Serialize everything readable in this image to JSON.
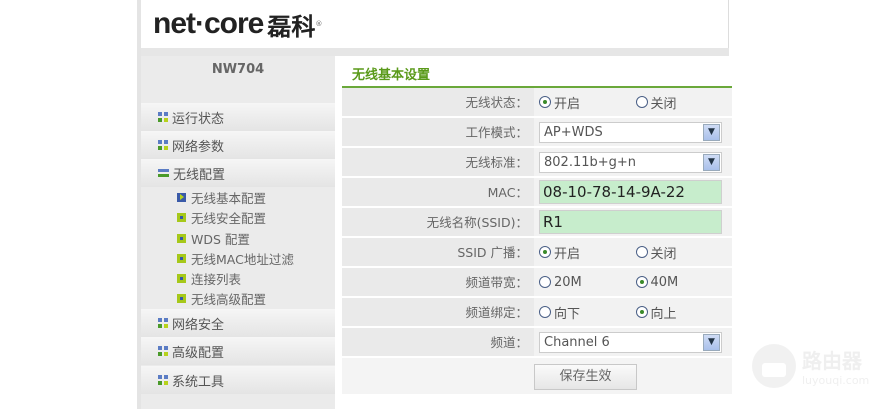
{
  "header": {
    "brand": "net·core",
    "brand_cn": "磊科",
    "registered": "®"
  },
  "sidebar": {
    "model": "NW704",
    "items": [
      {
        "label": "运行状态"
      },
      {
        "label": "网络参数"
      },
      {
        "label": "无线配置"
      },
      {
        "label": "网络安全"
      },
      {
        "label": "高级配置"
      },
      {
        "label": "系统工具"
      }
    ],
    "subitems": [
      {
        "label": "无线基本配置"
      },
      {
        "label": "无线安全配置"
      },
      {
        "label": "WDS 配置"
      },
      {
        "label": "无线MAC地址过滤"
      },
      {
        "label": "连接列表"
      },
      {
        "label": "无线高级配置"
      }
    ]
  },
  "main": {
    "title": "无线基本设置",
    "wireless_status": {
      "label": "无线状态：",
      "on": "开启",
      "off": "关闭"
    },
    "work_mode": {
      "label": "工作模式：",
      "value": "AP+WDS"
    },
    "standard": {
      "label": "无线标准：",
      "value": "802.11b+g+n"
    },
    "mac": {
      "label": "MAC：",
      "value": "08-10-78-14-9A-22"
    },
    "ssid": {
      "label": "无线名称(SSID)：",
      "value": "R1"
    },
    "ssid_broadcast": {
      "label": "SSID 广播：",
      "on": "开启",
      "off": "关闭"
    },
    "bandwidth": {
      "label": "频道带宽：",
      "opt1": "20M",
      "opt2": "40M"
    },
    "binding": {
      "label": "频道绑定：",
      "opt1": "向下",
      "opt2": "向上"
    },
    "channel": {
      "label": "频道：",
      "value": "Channel 6"
    },
    "save_label": "保存生效"
  },
  "watermark": {
    "cn": "路由器",
    "url": "luyouqi.com"
  }
}
